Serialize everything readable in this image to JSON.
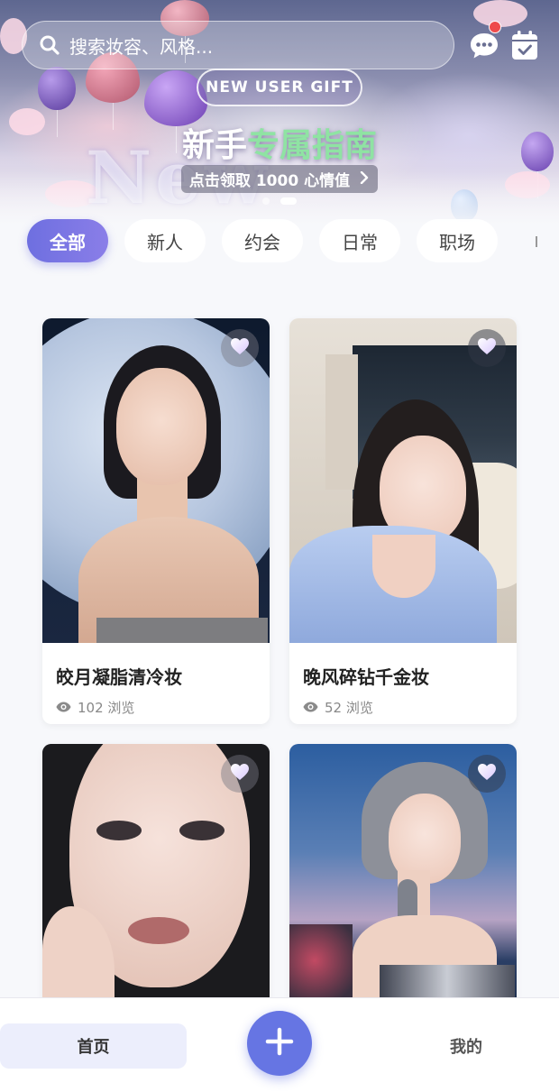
{
  "search": {
    "placeholder": "搜索妆容、风格..."
  },
  "header": {
    "message_badge": true
  },
  "banner": {
    "gift_label": "NEW USER GIFT",
    "headline_part1": "新手",
    "headline_part2": "专属指南",
    "reward_text": "点击领取 1000 心情值",
    "carousel": {
      "total": 2,
      "active": 2
    }
  },
  "tabs": [
    {
      "label": "全部",
      "active": true
    },
    {
      "label": "新人",
      "active": false
    },
    {
      "label": "约会",
      "active": false
    },
    {
      "label": "日常",
      "active": false
    },
    {
      "label": "职场",
      "active": false
    }
  ],
  "cards": [
    {
      "title": "皎月凝脂清冷妆",
      "views": "102 浏览"
    },
    {
      "title": "晚风碎钻千金妆",
      "views": "52 浏览"
    },
    {
      "title": "",
      "views": ""
    },
    {
      "title": "",
      "views": ""
    }
  ],
  "nav": {
    "home": "首页",
    "me": "我的"
  },
  "colors": {
    "accent": "#6675e3",
    "highlight": "#8fe3a3",
    "badge": "#ee4b4b"
  }
}
